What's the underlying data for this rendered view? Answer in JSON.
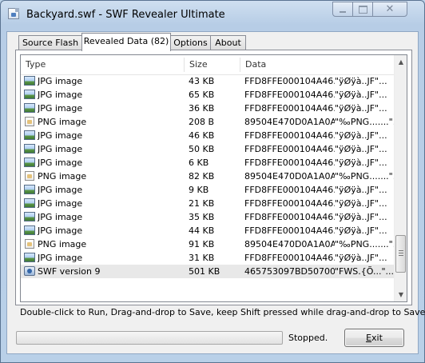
{
  "window": {
    "title": "Backyard.swf - SWF Revealer Ultimate",
    "app_icon": "swf-document-icon",
    "caption_buttons": [
      "minimize-icon",
      "maximize-icon",
      "close-icon"
    ]
  },
  "tabs": [
    {
      "label": "Source Flash",
      "active": false
    },
    {
      "label": "Revealed Data (82)",
      "active": true
    },
    {
      "label": "Options",
      "active": false
    },
    {
      "label": "About",
      "active": false
    }
  ],
  "table": {
    "columns": [
      "Type",
      "Size",
      "Data"
    ],
    "rows": [
      {
        "icon": "jpg",
        "type": "JPG image",
        "size": "43 KB",
        "data": "FFD8FFE000104A46...",
        "ascii": "\"ÿØÿà..JF\"..."
      },
      {
        "icon": "jpg",
        "type": "JPG image",
        "size": "65 KB",
        "data": "FFD8FFE000104A46...",
        "ascii": "\"ÿØÿà..JF\"..."
      },
      {
        "icon": "jpg",
        "type": "JPG image",
        "size": "36 KB",
        "data": "FFD8FFE000104A46...",
        "ascii": "\"ÿØÿà..JF\"..."
      },
      {
        "icon": "png",
        "type": "PNG image",
        "size": "208 B",
        "data": "89504E470D0A1A0A...",
        "ascii": "\"‰PNG.......\"..."
      },
      {
        "icon": "jpg",
        "type": "JPG image",
        "size": "46 KB",
        "data": "FFD8FFE000104A46...",
        "ascii": "\"ÿØÿà..JF\"..."
      },
      {
        "icon": "jpg",
        "type": "JPG image",
        "size": "50 KB",
        "data": "FFD8FFE000104A46...",
        "ascii": "\"ÿØÿà..JF\"..."
      },
      {
        "icon": "jpg",
        "type": "JPG image",
        "size": "6 KB",
        "data": "FFD8FFE000104A46...",
        "ascii": "\"ÿØÿà..JF\"..."
      },
      {
        "icon": "png",
        "type": "PNG image",
        "size": "82 KB",
        "data": "89504E470D0A1A0A...",
        "ascii": "\"‰PNG.......\"..."
      },
      {
        "icon": "jpg",
        "type": "JPG image",
        "size": "9 KB",
        "data": "FFD8FFE000104A46...",
        "ascii": "\"ÿØÿà..JF\"..."
      },
      {
        "icon": "jpg",
        "type": "JPG image",
        "size": "21 KB",
        "data": "FFD8FFE000104A46...",
        "ascii": "\"ÿØÿà..JF\"..."
      },
      {
        "icon": "jpg",
        "type": "JPG image",
        "size": "35 KB",
        "data": "FFD8FFE000104A46...",
        "ascii": "\"ÿØÿà..JF\"..."
      },
      {
        "icon": "jpg",
        "type": "JPG image",
        "size": "44 KB",
        "data": "FFD8FFE000104A46...",
        "ascii": "\"ÿØÿà..JF\"..."
      },
      {
        "icon": "png",
        "type": "PNG image",
        "size": "91 KB",
        "data": "89504E470D0A1A0A...",
        "ascii": "\"‰PNG.......\"..."
      },
      {
        "icon": "jpg",
        "type": "JPG image",
        "size": "31 KB",
        "data": "FFD8FFE000104A46...",
        "ascii": "\"ÿØÿà..JF\"..."
      },
      {
        "icon": "swf",
        "type": "SWF version 9",
        "size": "501 KB",
        "data": "465753097BD50700...",
        "ascii": "\"FWS.{Õ...\"..."
      }
    ],
    "selected_row": 14
  },
  "hint": "Double-click to Run, Drag-and-drop to Save, keep Shift pressed while drag-and-drop to Save All.",
  "progress": {
    "value": 0
  },
  "status": "Stopped.",
  "exit_button": {
    "mnemonic": "E",
    "rest": "xit"
  },
  "colors": {
    "progress_fill": "#3dbb4a",
    "selection": "#e8e8e8"
  }
}
